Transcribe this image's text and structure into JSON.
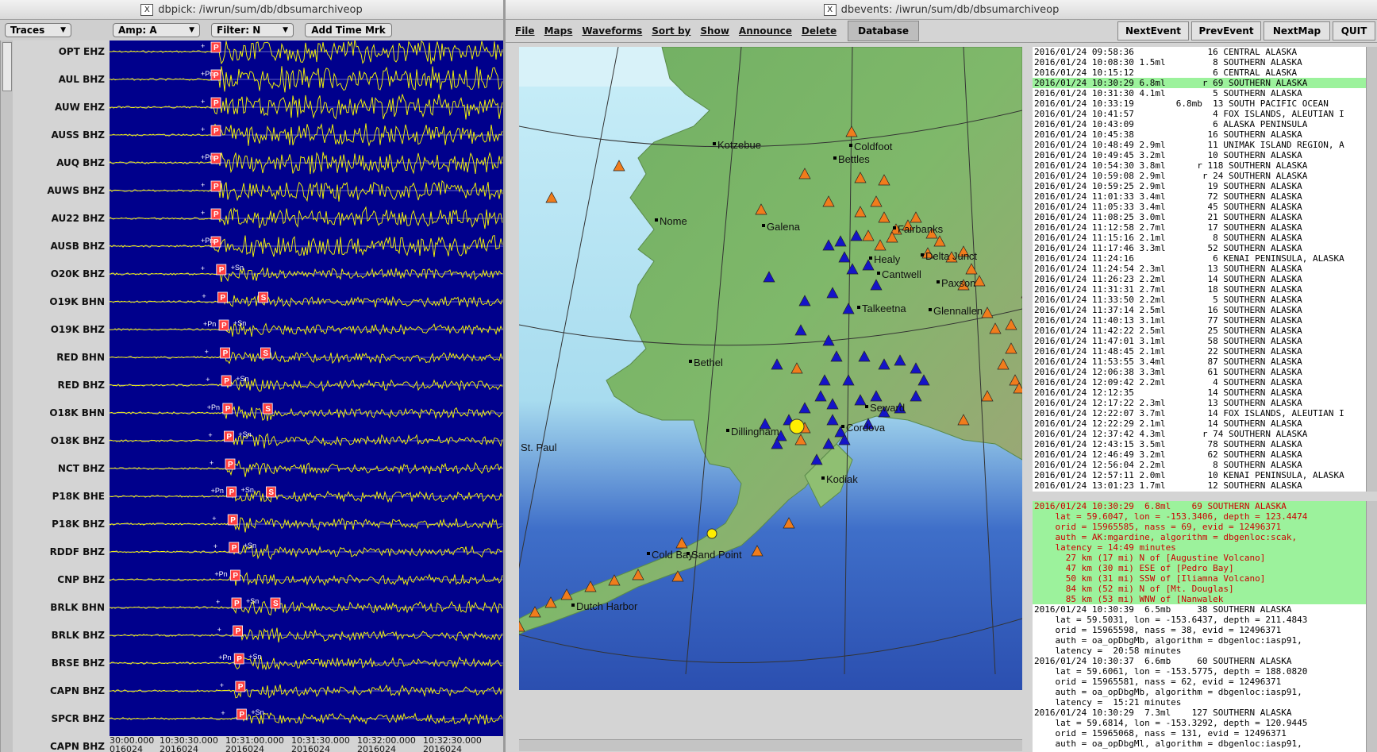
{
  "left_window": {
    "title": "dbpick: /iwrun/sum/db/dbsumarchiveop",
    "toolbar": {
      "traces": "Traces",
      "amp": "Amp: A",
      "filter": "Filter: N",
      "add_time": "Add Time Mrk"
    },
    "channels": [
      "OPT EHZ",
      "AUL BHZ",
      "AUW EHZ",
      "AUSS BHZ",
      "AUQ BHZ",
      "AUWS BHZ",
      "AU22 BHZ",
      "AUSB BHZ",
      "O20K BHZ",
      "O19K BHN",
      "O19K BHZ",
      "RED BHN",
      "RED BHZ",
      "O18K BHN",
      "O18K BHZ",
      "NCT BHZ",
      "P18K BHE",
      "P18K BHZ",
      "RDDF BHZ",
      "CNP BHZ",
      "BRLK BHN",
      "BRLK BHZ",
      "BRSE BHZ",
      "CAPN BHZ",
      "SPCR BHZ",
      "CAPN BHZ"
    ],
    "time_ticks": [
      "30:00.000",
      "10:30:30.000",
      "10:31:00.000",
      "10:31:30.000",
      "10:32:00.000",
      "10:32:30.000"
    ],
    "date_ticks": [
      "016024",
      "2016024",
      "2016024",
      "2016024",
      "2016024",
      "2016024"
    ],
    "phase_labels": {
      "p": "P",
      "s": "S",
      "pn": "+Pn",
      "sn": "+Sn",
      "plus": "+"
    }
  },
  "right_window": {
    "title": "dbevents: /iwrun/sum/db/dbsumarchiveop",
    "menu": [
      "File",
      "Maps",
      "Waveforms",
      "Sort by",
      "Show",
      "Announce",
      "Delete"
    ],
    "database": "Database",
    "nav": [
      "NextEvent",
      "PrevEvent",
      "NextMap",
      "QUIT"
    ],
    "map_labels": [
      {
        "name": "Kotzebue"
      },
      {
        "name": "Coldfoot"
      },
      {
        "name": "Bettles"
      },
      {
        "name": "Nome"
      },
      {
        "name": "Galena"
      },
      {
        "name": "Fairbanks"
      },
      {
        "name": "Healy"
      },
      {
        "name": "Delta Junct"
      },
      {
        "name": "Cantwell"
      },
      {
        "name": "Paxson"
      },
      {
        "name": "Talkeetna"
      },
      {
        "name": "Glennallen"
      },
      {
        "name": "Bethel"
      },
      {
        "name": "Seward"
      },
      {
        "name": "Cordova"
      },
      {
        "name": "Dillingham"
      },
      {
        "name": "St. Paul"
      },
      {
        "name": "Kodiak"
      },
      {
        "name": "Sand Point"
      },
      {
        "name": "Cold Bay"
      },
      {
        "name": "Dutch Harbor"
      }
    ],
    "events": [
      "2016/01/24 09:58:36              16 CENTRAL ALASKA",
      "2016/01/24 10:08:30 1.5ml         8 SOUTHERN ALASKA",
      "2016/01/24 10:15:12               6 CENTRAL ALASKA",
      "2016/01/24 10:30:29 6.8ml       r 69 SOUTHERN ALASKA",
      "2016/01/24 10:31:30 4.1ml         5 SOUTHERN ALASKA",
      "2016/01/24 10:33:19        6.8mb  13 SOUTH PACIFIC OCEAN",
      "2016/01/24 10:41:57               4 FOX ISLANDS, ALEUTIAN I",
      "2016/01/24 10:43:09               6 ALASKA PENINSULA",
      "2016/01/24 10:45:38              16 SOUTHERN ALASKA",
      "2016/01/24 10:48:49 2.9ml        11 UNIMAK ISLAND REGION, A",
      "2016/01/24 10:49:45 3.2ml        10 SOUTHERN ALASKA",
      "2016/01/24 10:54:30 3.8ml      r 118 SOUTHERN ALASKA",
      "2016/01/24 10:59:08 2.9ml       r 24 SOUTHERN ALASKA",
      "2016/01/24 10:59:25 2.9ml        19 SOUTHERN ALASKA",
      "2016/01/24 11:01:33 3.4ml        72 SOUTHERN ALASKA",
      "2016/01/24 11:05:33 3.4ml        45 SOUTHERN ALASKA",
      "2016/01/24 11:08:25 3.0ml        21 SOUTHERN ALASKA",
      "2016/01/24 11:12:58 2.7ml        17 SOUTHERN ALASKA",
      "2016/01/24 11:15:16 2.1ml         8 SOUTHERN ALASKA",
      "2016/01/24 11:17:46 3.3ml        52 SOUTHERN ALASKA",
      "2016/01/24 11:24:16               6 KENAI PENINSULA, ALASKA",
      "2016/01/24 11:24:54 2.3ml        13 SOUTHERN ALASKA",
      "2016/01/24 11:26:23 2.2ml        14 SOUTHERN ALASKA",
      "2016/01/24 11:31:31 2.7ml        18 SOUTHERN ALASKA",
      "2016/01/24 11:33:50 2.2ml         5 SOUTHERN ALASKA",
      "2016/01/24 11:37:14 2.5ml        16 SOUTHERN ALASKA",
      "2016/01/24 11:40:13 3.1ml        77 SOUTHERN ALASKA",
      "2016/01/24 11:42:22 2.5ml        25 SOUTHERN ALASKA",
      "2016/01/24 11:47:01 3.1ml        58 SOUTHERN ALASKA",
      "2016/01/24 11:48:45 2.1ml        22 SOUTHERN ALASKA",
      "2016/01/24 11:53:55 3.4ml        87 SOUTHERN ALASKA",
      "2016/01/24 12:06:38 3.3ml        61 SOUTHERN ALASKA",
      "2016/01/24 12:09:42 2.2ml         4 SOUTHERN ALASKA",
      "2016/01/24 12:12:35              14 SOUTHERN ALASKA",
      "2016/01/24 12:17:22 2.3ml        13 SOUTHERN ALASKA",
      "2016/01/24 12:22:07 3.7ml        14 FOX ISLANDS, ALEUTIAN I",
      "2016/01/24 12:22:29 2.1ml        14 SOUTHERN ALASKA",
      "2016/01/24 12:37:42 4.3ml       r 74 SOUTHERN ALASKA",
      "2016/01/24 12:43:15 3.5ml        78 SOUTHERN ALASKA",
      "2016/01/24 12:46:49 3.2ml        62 SOUTHERN ALASKA",
      "2016/01/24 12:56:04 2.2ml         8 SOUTHERN ALASKA",
      "2016/01/24 12:57:11 2.0ml        10 KENAI PENINSULA, ALASKA",
      "2016/01/24 13:01:23 1.7ml        12 SOUTHERN ALASKA"
    ],
    "selected_index": 3,
    "detail_highlight": [
      "2016/01/24 10:30:29  6.8ml    69 SOUTHERN ALASKA",
      "    lat = 59.6047, lon = -153.3406, depth = 123.4474",
      "    orid = 15965585, nass = 69, evid = 12496371",
      "    auth = AK:mgardine, algorithm = dbgenloc:scak,",
      "    latency = 14:49 minutes",
      "      27 km (17 mi) N of [Augustine Volcano]",
      "      47 km (30 mi) ESE of [Pedro Bay]",
      "      50 km (31 mi) SSW of [Iliamna Volcano]",
      "      84 km (52 mi) N of [Mt. Douglas]",
      "      85 km (53 mi) WNW of [Nanwalek"
    ],
    "detail_rest": [
      "2016/01/24 10:30:39  6.5mb     38 SOUTHERN ALASKA",
      "    lat = 59.5031, lon = -153.6437, depth = 211.4843",
      "    orid = 15965598, nass = 38, evid = 12496371",
      "    auth = oa_opDbgMb, algorithm = dbgenloc:iasp91,",
      "    latency =  20:58 minutes",
      "2016/01/24 10:30:37  6.6mb     60 SOUTHERN ALASKA",
      "    lat = 59.6061, lon = -153.5775, depth = 188.0820",
      "    orid = 15965581, nass = 62, evid = 12496371",
      "    auth = oa_opDbgMb, algorithm = dbgenloc:iasp91,",
      "    latency =  15:21 minutes",
      "2016/01/24 10:30:29  7.3ml    127 SOUTHERN ALASKA",
      "    lat = 59.6814, lon = -153.3292, depth = 120.9445",
      "    orid = 15965068, nass = 131, evid = 12496371",
      "    auth = oa_opDbgMl, algorithm = dbgenloc:iasp91,"
    ]
  }
}
